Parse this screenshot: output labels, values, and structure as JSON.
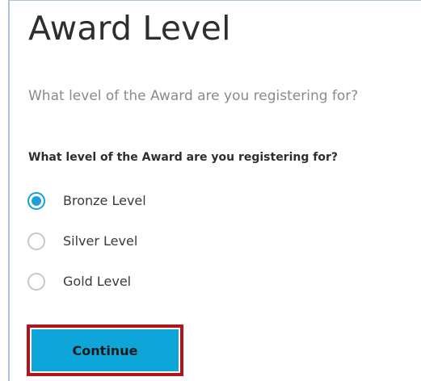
{
  "page": {
    "title": "Award Level",
    "intro": "What level of the Award are you registering for?"
  },
  "form": {
    "question": "What level of the Award are you registering for?",
    "options": [
      {
        "label": "Bronze Level",
        "selected": true
      },
      {
        "label": "Silver Level",
        "selected": false
      },
      {
        "label": "Gold Level",
        "selected": false
      }
    ]
  },
  "actions": {
    "continue_label": "Continue"
  },
  "colors": {
    "accent": "#0ea5d9",
    "radio_selected": "#1a9fd6",
    "highlight_border": "#b3141c"
  }
}
